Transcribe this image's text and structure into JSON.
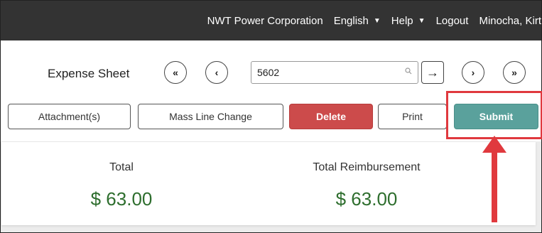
{
  "header": {
    "company": "NWT Power Corporation",
    "language": "English",
    "help": "Help",
    "logout": "Logout",
    "user": "Minocha, Kirt"
  },
  "sheet": {
    "title": "Expense Sheet",
    "number": "5602",
    "nav": {
      "first": "«",
      "prev": "‹",
      "go": "→",
      "next": "›",
      "last": "»"
    }
  },
  "actions": {
    "attachments": "Attachment(s)",
    "mass_line_change": "Mass Line Change",
    "delete": "Delete",
    "print": "Print",
    "submit": "Submit"
  },
  "summary": {
    "total_label": "Total",
    "total_value": "$ 63.00",
    "reimbursement_label": "Total Reimbursement",
    "reimbursement_value": "$ 63.00"
  },
  "colors": {
    "header_bg": "#333333",
    "delete_bg": "#cc4b4b",
    "submit_bg": "#5aa19c",
    "amount_text": "#2e6e2e",
    "annotation": "#e0393e"
  },
  "icons": {
    "dropdown": "caret-down-icon",
    "search": "magnifier-icon",
    "annotation": "red-arrow-icon"
  }
}
